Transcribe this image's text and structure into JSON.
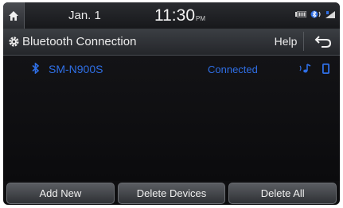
{
  "status_bar": {
    "date": "Jan. 1",
    "time": "11:30",
    "ampm": "PM"
  },
  "title_bar": {
    "title": "Bluetooth Connection",
    "help_label": "Help"
  },
  "device_list": [
    {
      "name": "SM-N900S",
      "status": "Connected"
    }
  ],
  "bottom_bar": {
    "add_new_label": "Add New",
    "delete_devices_label": "Delete Devices",
    "delete_all_label": "Delete All"
  },
  "colors": {
    "accent_blue": "#2f6fe6"
  },
  "icons": [
    "home-icon",
    "battery-icon",
    "bluetooth-audio-icon",
    "signal-icon",
    "gear-icon",
    "back-icon",
    "bluetooth-icon",
    "audio-icon",
    "phone-icon"
  ]
}
